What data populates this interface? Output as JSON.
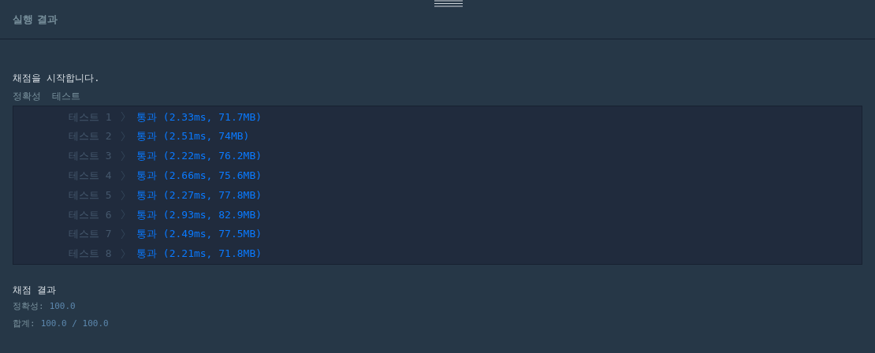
{
  "panel": {
    "title": "실행 결과"
  },
  "log": {
    "intro": "채점을 시작합니다.",
    "section": "정확성  테스트",
    "tests": [
      {
        "label": "테스트 1",
        "kind": "pass",
        "result": "통과 (2.33ms, 71.7MB)"
      },
      {
        "label": "테스트 2",
        "kind": "pass",
        "result": "통과 (2.51ms, 74MB)"
      },
      {
        "label": "테스트 3",
        "kind": "pass",
        "result": "통과 (2.22ms, 76.2MB)"
      },
      {
        "label": "테스트 4",
        "kind": "pass",
        "result": "통과 (2.66ms, 75.6MB)"
      },
      {
        "label": "테스트 5",
        "kind": "pass",
        "result": "통과 (2.27ms, 77.8MB)"
      },
      {
        "label": "테스트 6",
        "kind": "pass",
        "result": "통과 (2.93ms, 82.9MB)"
      },
      {
        "label": "테스트 7",
        "kind": "pass",
        "result": "통과 (2.49ms, 77.5MB)"
      },
      {
        "label": "테스트 8",
        "kind": "pass",
        "result": "통과 (2.21ms, 71.8MB)"
      }
    ]
  },
  "summary": {
    "title": "채점 결과",
    "lines": [
      {
        "label": "정확성:",
        "value": "100.0"
      },
      {
        "label": "합계:",
        "value": "100.0 / 100.0"
      }
    ]
  }
}
